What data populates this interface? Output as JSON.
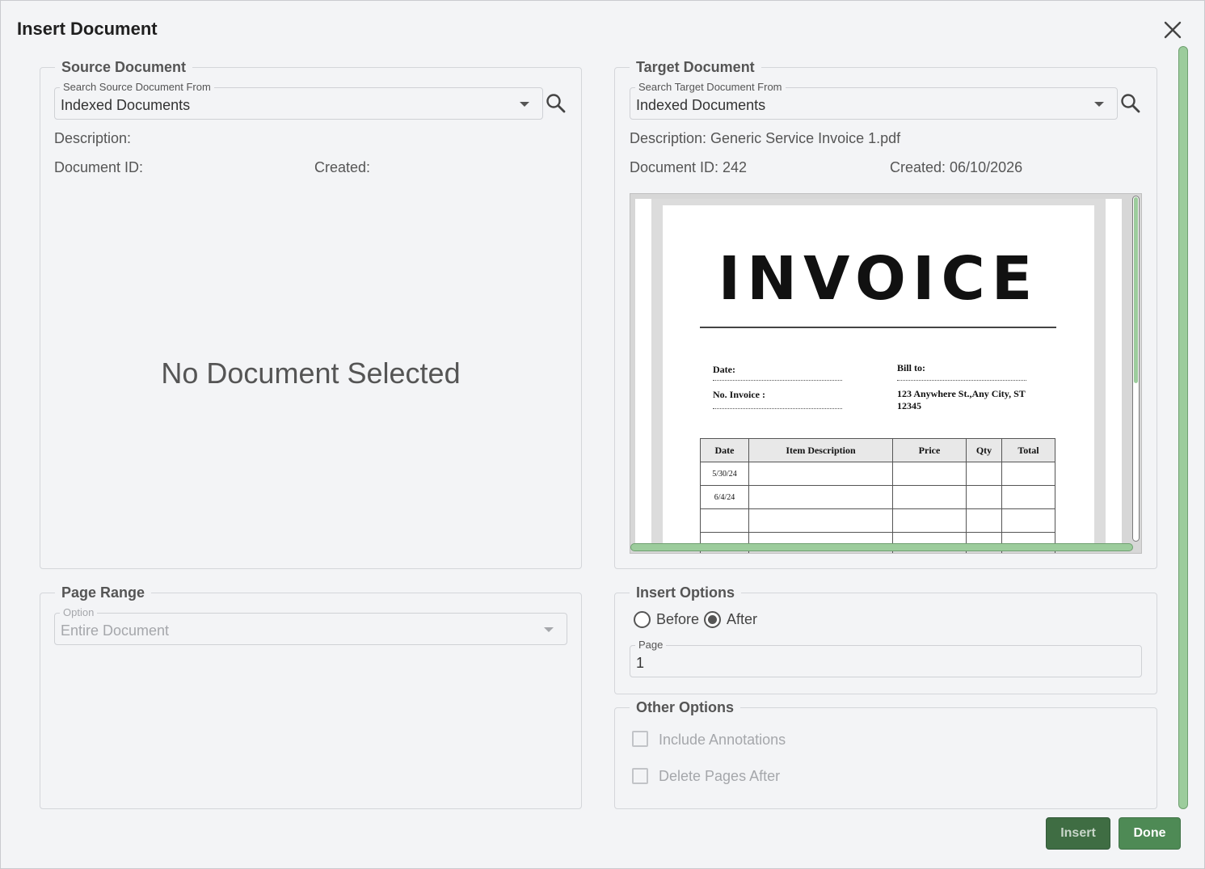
{
  "dialog": {
    "title": "Insert Document"
  },
  "source": {
    "legend": "Source Document",
    "search_label": "Search Source Document From",
    "search_value": "Indexed Documents",
    "description_label": "Description:",
    "doc_id_label": "Document ID:",
    "created_label": "Created:",
    "empty_message": "No Document Selected"
  },
  "target": {
    "legend": "Target Document",
    "search_label": "Search Target Document From",
    "search_value": "Indexed Documents",
    "description": "Description: Generic Service Invoice 1.pdf",
    "doc_id": "Document ID: 242",
    "created": "Created: 06/10/2026"
  },
  "preview": {
    "title": "INVOICE",
    "date_label": "Date:",
    "invoice_no_label": "No. Invoice :",
    "bill_to_label": "Bill to:",
    "address_line1": "123 Anywhere St.,Any City, ST",
    "address_line2": "12345",
    "table_headers": [
      "Date",
      "Item Description",
      "Price",
      "Qty",
      "Total"
    ],
    "table_rows": [
      [
        "5/30/24",
        "",
        "",
        "",
        ""
      ],
      [
        "6/4/24",
        "",
        "",
        "",
        ""
      ],
      [
        "",
        "",
        "",
        "",
        ""
      ],
      [
        "",
        "",
        "",
        "",
        ""
      ]
    ]
  },
  "page_range": {
    "legend": "Page Range",
    "option_label": "Option",
    "option_value": "Entire Document"
  },
  "insert_options": {
    "legend": "Insert Options",
    "before_label": "Before",
    "after_label": "After",
    "selected": "After",
    "page_label": "Page",
    "page_value": "1"
  },
  "other_options": {
    "legend": "Other Options",
    "include_annotations_label": "Include Annotations",
    "delete_pages_after_label": "Delete Pages After"
  },
  "buttons": {
    "insert": "Insert",
    "done": "Done"
  },
  "colors": {
    "accent": "#4e8a55",
    "scroll": "#9ccc9c",
    "background": "#f3f4f6"
  }
}
